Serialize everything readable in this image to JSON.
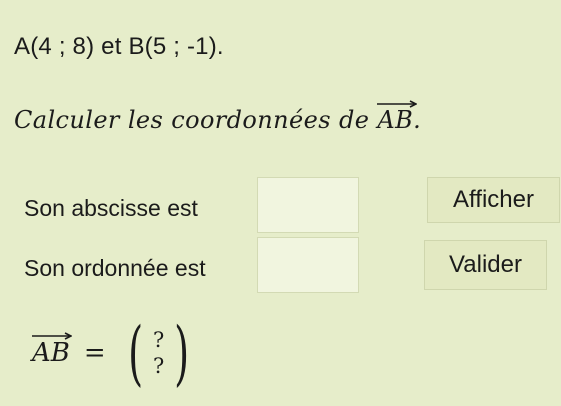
{
  "given": {
    "text": "A(4 ; 8) et B(5 ; -1)."
  },
  "question": {
    "prefix": "Calculer les coordonnées de ",
    "vector": "AB",
    "suffix": "."
  },
  "rows": [
    {
      "label": "Son abscisse est",
      "input_value": "",
      "button_label": "Afficher"
    },
    {
      "label": "Son ordonnée est",
      "input_value": "",
      "button_label": "Valider"
    }
  ],
  "result": {
    "vector": "AB",
    "equals": "=",
    "top": "?",
    "bottom": "?"
  }
}
